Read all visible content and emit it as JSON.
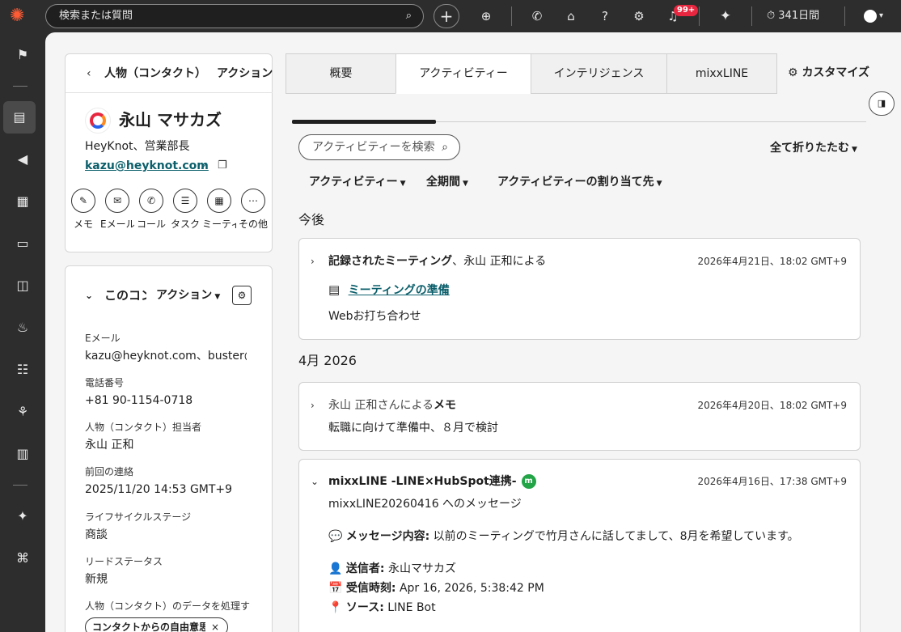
{
  "topbar": {
    "search_placeholder": "検索または質問",
    "notifications_badge": "99+",
    "timer_label": "341日間"
  },
  "breadcrumb": {
    "object_label": "人物（コンタクト）",
    "actions_label": "アクション"
  },
  "contact": {
    "name": "永山 マサカズ",
    "title_company": "HeyKnot、営業部長",
    "email": "kazu@heyknot.com",
    "actions": [
      {
        "label": "メモ",
        "icon": "note-icon",
        "glyph": "✎"
      },
      {
        "label": "Eメール",
        "icon": "email-icon",
        "glyph": "✉"
      },
      {
        "label": "コール",
        "icon": "phone-icon",
        "glyph": "✆"
      },
      {
        "label": "タスク",
        "icon": "task-icon",
        "glyph": "☰"
      },
      {
        "label": "ミーティング",
        "icon": "meeting-icon",
        "glyph": "▦"
      },
      {
        "label": "その他",
        "icon": "more-icon",
        "glyph": "⋯"
      }
    ]
  },
  "about": {
    "title": "このコンタクトについて",
    "actions_label": "アクション",
    "properties": [
      {
        "label": "Eメール",
        "value": "kazu@heyknot.com、buster@heyknot.com"
      },
      {
        "label": "電話番号",
        "value": "+81 90-1154-0718"
      },
      {
        "label": "人物（コンタクト）担当者",
        "value": "永山 正和"
      },
      {
        "label": "前回の連絡",
        "value": "2025/11/20 14:53 GMT+9"
      },
      {
        "label": "ライフサイクルステージ",
        "value": "商談"
      },
      {
        "label": "リードステータス",
        "value": "新規"
      }
    ],
    "consent_label": "人物（コンタクト）のデータを処理する法的根拠",
    "consent_chip": "コンタクトからの自由意思による同意"
  },
  "tabs": [
    {
      "label": "概要"
    },
    {
      "label": "アクティビティー"
    },
    {
      "label": "インテリジェンス"
    },
    {
      "label": "mixxLINE"
    }
  ],
  "customize_label": "カスタマイズ",
  "activity": {
    "search_placeholder": "アクティビティーを検索",
    "collapse_all": "全て折りたたむ",
    "progress": 0.25,
    "filters": [
      {
        "label": "アクティビティー"
      },
      {
        "label": "全期間"
      },
      {
        "label": "アクティビティーの割り当て先"
      }
    ],
    "group_upcoming": "今後",
    "group_month": "4月 2026",
    "meeting": {
      "title_bold": "記録されたミーティング",
      "title_rest": "、永山 正和による",
      "date": "2026年4月21日、18:02 GMT+9",
      "link": "ミーティングの準備",
      "body": "Webお打ち合わせ"
    },
    "note": {
      "title_rest": "永山 正和さんによる",
      "title_bold": "メモ",
      "date": "2026年4月20日、18:02 GMT+9",
      "body": "転職に向けて準備中、８月で検討"
    },
    "line": {
      "title": "mixxLINE -LINE×HubSpot連携-",
      "badge": "m",
      "date": "2026年4月16日、17:38 GMT+9",
      "subtitle": "mixxLINE20260416 へのメッセージ",
      "message_label": "メッセージ内容:",
      "message_value": "以前のミーティングで竹月さんに話してまして、8月を希望しています。",
      "sender_label": "送信者:",
      "sender_value": "永山マサカズ",
      "received_label": "受信時刻:",
      "received_value": "Apr 16, 2026, 5:38:42 PM",
      "source_label": "ソース:",
      "source_value": "LINE Bot"
    }
  }
}
